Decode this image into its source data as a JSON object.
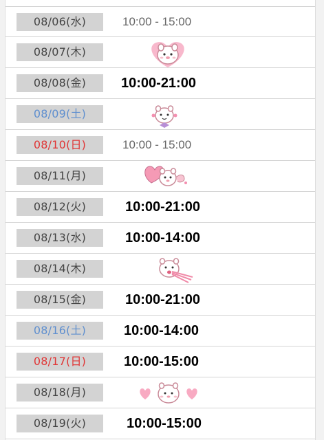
{
  "schedule": [
    {
      "date": "08/06(水)",
      "time": "10:00 - 15:00",
      "style": "normal",
      "day": "weekday"
    },
    {
      "date": "08/07(木)",
      "time": "",
      "style": "sticker",
      "day": "weekday",
      "sticker": "bear-hearts-sticker"
    },
    {
      "date": "08/08(金)",
      "time": "10:00-21:00",
      "style": "bold",
      "day": "weekday"
    },
    {
      "date": "08/09(土)",
      "time": "",
      "style": "sticker",
      "day": "sat",
      "sticker": "bear-bow-sticker"
    },
    {
      "date": "08/10(日)",
      "time": "10:00 - 15:00",
      "style": "normal",
      "day": "sun"
    },
    {
      "date": "08/11(月)",
      "time": "",
      "style": "sticker",
      "day": "weekday",
      "sticker": "bear-balloon-sticker"
    },
    {
      "date": "08/12(火)",
      "time": "10:00-21:00",
      "style": "bold",
      "day": "weekday"
    },
    {
      "date": "08/13(水)",
      "time": "10:00-14:00",
      "style": "bold",
      "day": "weekday"
    },
    {
      "date": "08/14(木)",
      "time": "",
      "style": "sticker",
      "day": "weekday",
      "sticker": "bear-crying-sticker"
    },
    {
      "date": "08/15(金)",
      "time": "10:00-21:00",
      "style": "bold",
      "day": "weekday"
    },
    {
      "date": "08/16(土)",
      "time": "10:00-14:00",
      "style": "bold",
      "day": "sat"
    },
    {
      "date": "08/17(日)",
      "time": "10:00-15:00",
      "style": "bold",
      "day": "sun"
    },
    {
      "date": "08/18(月)",
      "time": "",
      "style": "sticker",
      "day": "weekday",
      "sticker": "bear-two-hearts-sticker"
    },
    {
      "date": "08/19(火)",
      "time": "10:00-15:00",
      "style": "bold",
      "day": "weekday"
    }
  ],
  "colors": {
    "saturday": "#5f8fcf",
    "sunday": "#e03636",
    "date_bg": "#d3d3d3",
    "sticker_pink": "#f4a7c0"
  }
}
